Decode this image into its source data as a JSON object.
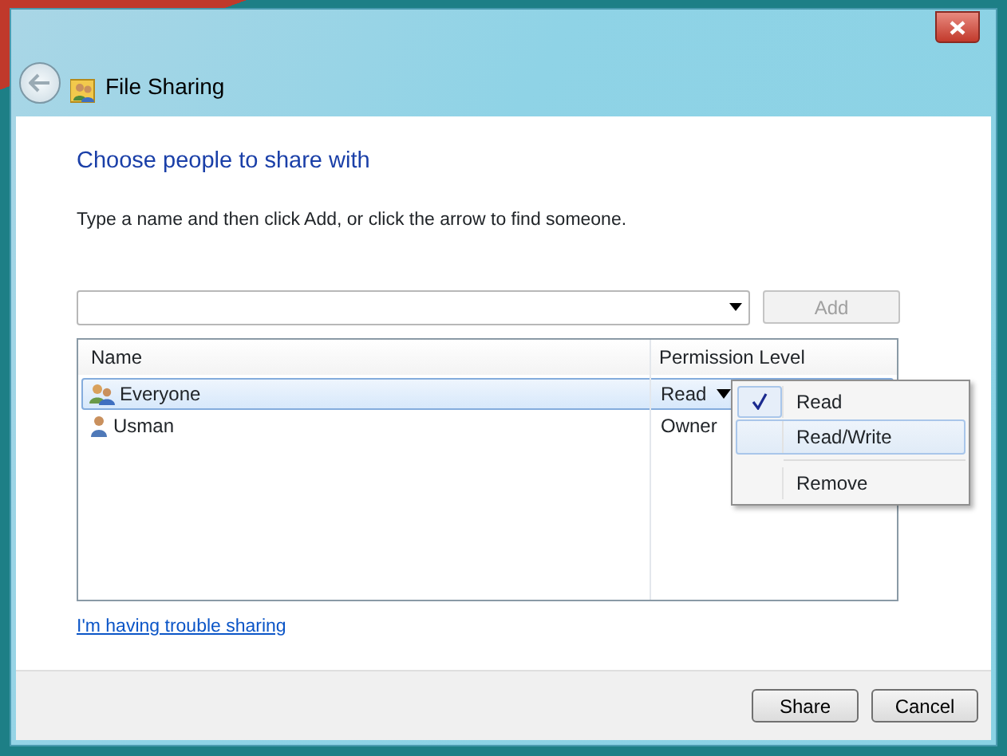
{
  "window": {
    "title": "File Sharing"
  },
  "heading": "Choose people to share with",
  "instruction": "Type a name and then click Add, or click the arrow to find someone.",
  "add_button": {
    "label": "Add",
    "disabled": true
  },
  "table": {
    "columns": [
      "Name",
      "Permission Level"
    ],
    "rows": [
      {
        "name": "Everyone",
        "kind": "group",
        "permission": "Read",
        "has_dropdown": true,
        "selected": true
      },
      {
        "name": "Usman",
        "kind": "user",
        "permission": "Owner",
        "has_dropdown": false,
        "selected": false
      }
    ]
  },
  "menu": {
    "items": [
      {
        "label": "Read",
        "checked": true,
        "highlighted": false
      },
      {
        "label": "Read/Write",
        "checked": false,
        "highlighted": true
      },
      {
        "label": "Remove",
        "checked": false,
        "highlighted": false,
        "separator_before": true
      }
    ]
  },
  "help_link": "I'm having trouble sharing",
  "buttons": [
    "Share",
    "Cancel"
  ]
}
